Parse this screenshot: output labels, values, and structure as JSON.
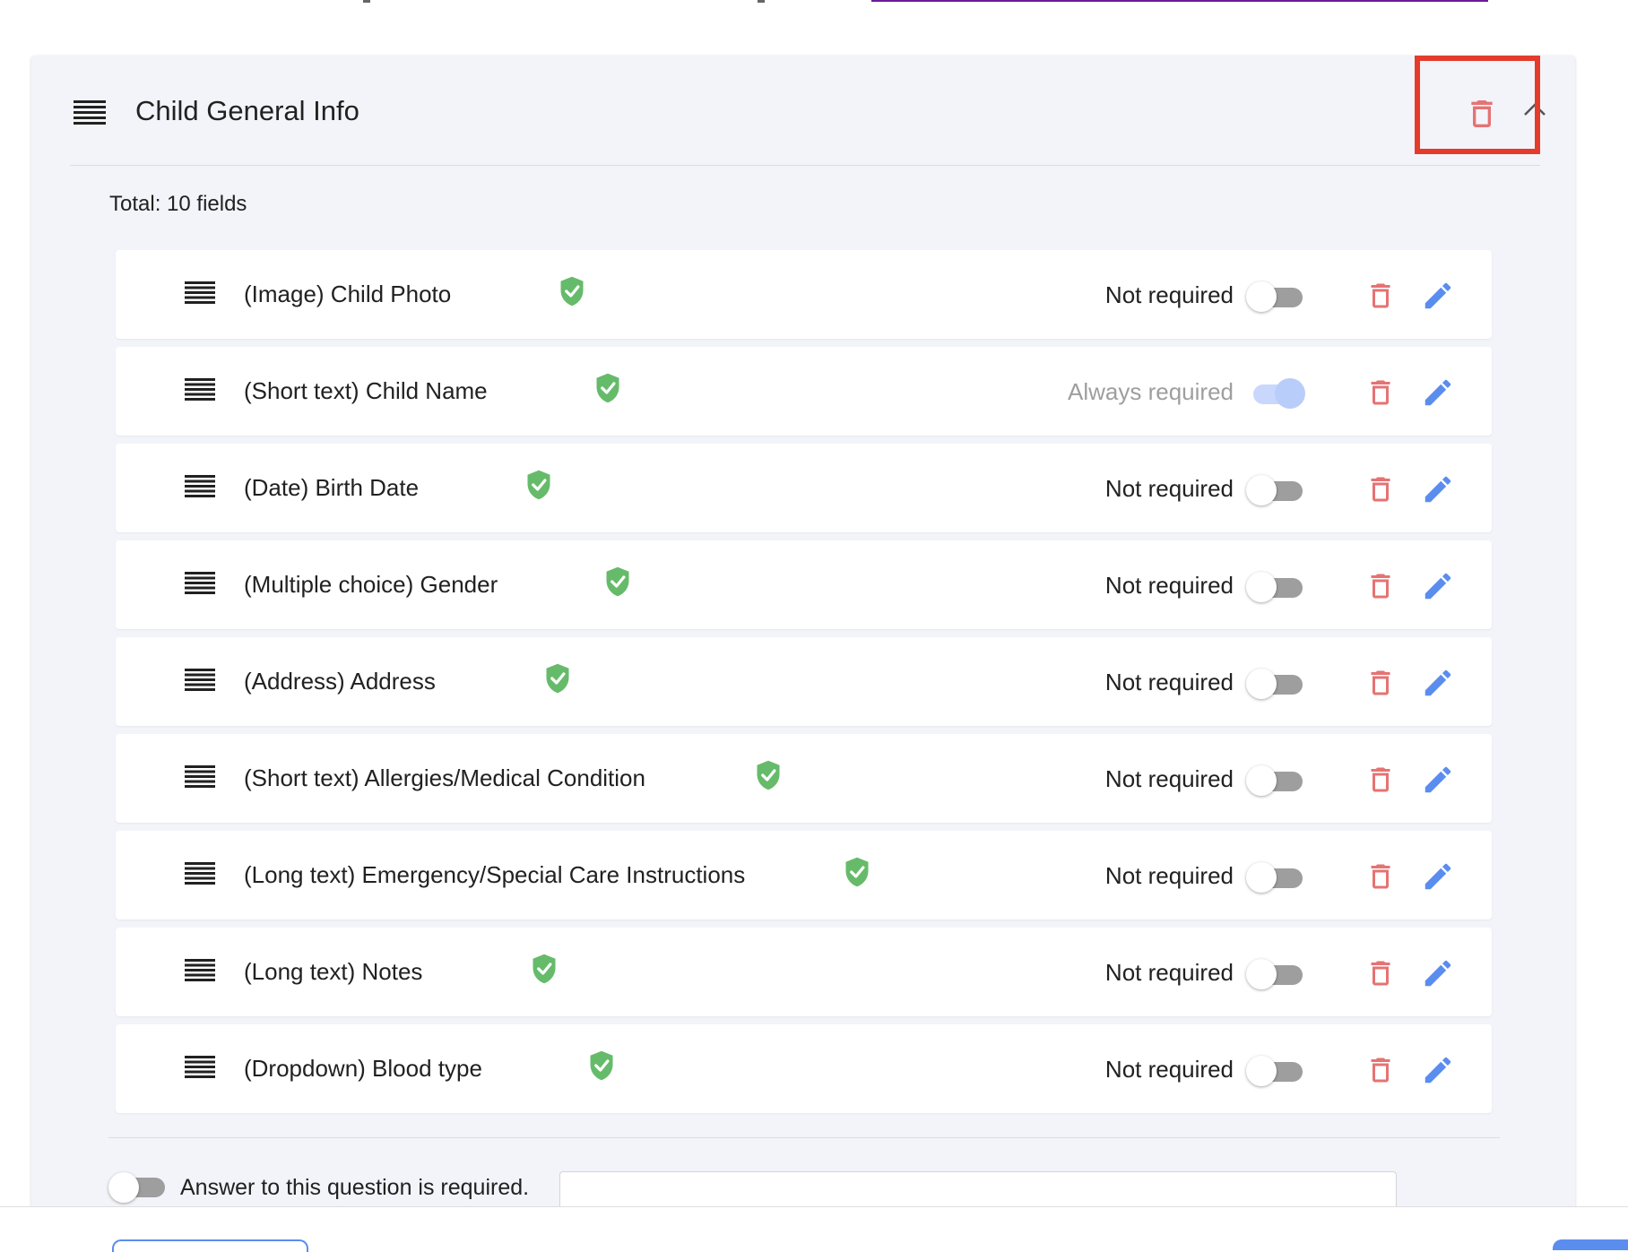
{
  "section": {
    "title": "Child General Info",
    "total_label": "Total: 10 fields"
  },
  "fields": [
    {
      "label": "(Image) Child Photo",
      "required_label": "Not required",
      "required_state": "off"
    },
    {
      "label": "(Short text) Child Name",
      "required_label": "Always required",
      "required_state": "on-disabled"
    },
    {
      "label": "(Date) Birth Date",
      "required_label": "Not required",
      "required_state": "off"
    },
    {
      "label": "(Multiple choice) Gender",
      "required_label": "Not required",
      "required_state": "off"
    },
    {
      "label": "(Address) Address",
      "required_label": "Not required",
      "required_state": "off"
    },
    {
      "label": "(Short text) Allergies/Medical Condition",
      "required_label": "Not required",
      "required_state": "off"
    },
    {
      "label": "(Long text) Emergency/Special Care Instructions",
      "required_label": "Not required",
      "required_state": "off"
    },
    {
      "label": "(Long text) Notes",
      "required_label": "Not required",
      "required_state": "off"
    },
    {
      "label": "(Dropdown) Blood type",
      "required_label": "Not required",
      "required_state": "off"
    }
  ],
  "footer": {
    "required_toggle_label": "Answer to this question is required.",
    "required_toggle_state": "off"
  },
  "icons": {
    "drag": "drag-handle-icon",
    "verified": "verified-shield-icon",
    "delete": "trash-icon",
    "edit": "pencil-icon",
    "collapse": "chevron-up-icon"
  },
  "colors": {
    "delete": "#e57373",
    "edit": "#5b8def",
    "verified": "#66bb6a",
    "highlight": "#e43b2c",
    "card_background": "#f3f4f9"
  }
}
